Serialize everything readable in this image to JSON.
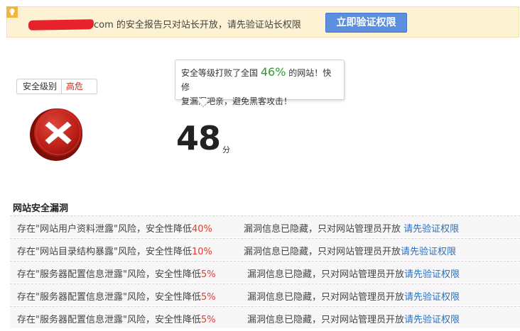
{
  "notice": {
    "message": "com 的安全报告只对站长开放，请先验证站长权限",
    "button": "立即验证权限"
  },
  "level": {
    "label": "安全级别",
    "value": "高危"
  },
  "tooltip": {
    "prefix": "安全等级打败了全国",
    "percent": "46%",
    "suffix": "的网站！快修",
    "line2": "复漏洞吧亲，避免黑客攻击！"
  },
  "score": {
    "value": "48",
    "unit": "分"
  },
  "section_title": "网站安全漏洞",
  "vulns": [
    {
      "desc": "存在\"网站用户资料泄露\"风险，安全性降低",
      "pct": "40%",
      "hidden": "漏洞信息已隐藏，只对网站管理员开放",
      "link": "请先验证权限"
    },
    {
      "desc": "存在\"网站目录结构暴露\"风险，安全性降低",
      "pct": "10%",
      "hidden": "漏洞信息已隐藏，只对网站管理员开放",
      "link": "请先验证权限"
    },
    {
      "desc": "存在\"服务器配置信息泄露\"风险，安全性降低",
      "pct": "5%",
      "hidden": "漏洞信息已隐藏，只对网站管理员开放",
      "link": "请先验证权限"
    },
    {
      "desc": "存在\"服务器配置信息泄露\"风险，安全性降低",
      "pct": "5%",
      "hidden": "漏洞信息已隐藏，只对网站管理员开放",
      "link": "请先验证权限"
    },
    {
      "desc": "存在\"服务器配置信息泄露\"风险，安全性降低",
      "pct": "5%",
      "hidden": "漏洞信息已隐藏，只对网站管理员开放",
      "link": "请先验证权限"
    }
  ],
  "colors": {
    "accent": "#5c8fe0",
    "danger": "#d0261c",
    "good": "#2f9b2f",
    "link": "#2f6fbf"
  },
  "icons": [
    "lightbulb-icon",
    "danger-x-icon"
  ]
}
